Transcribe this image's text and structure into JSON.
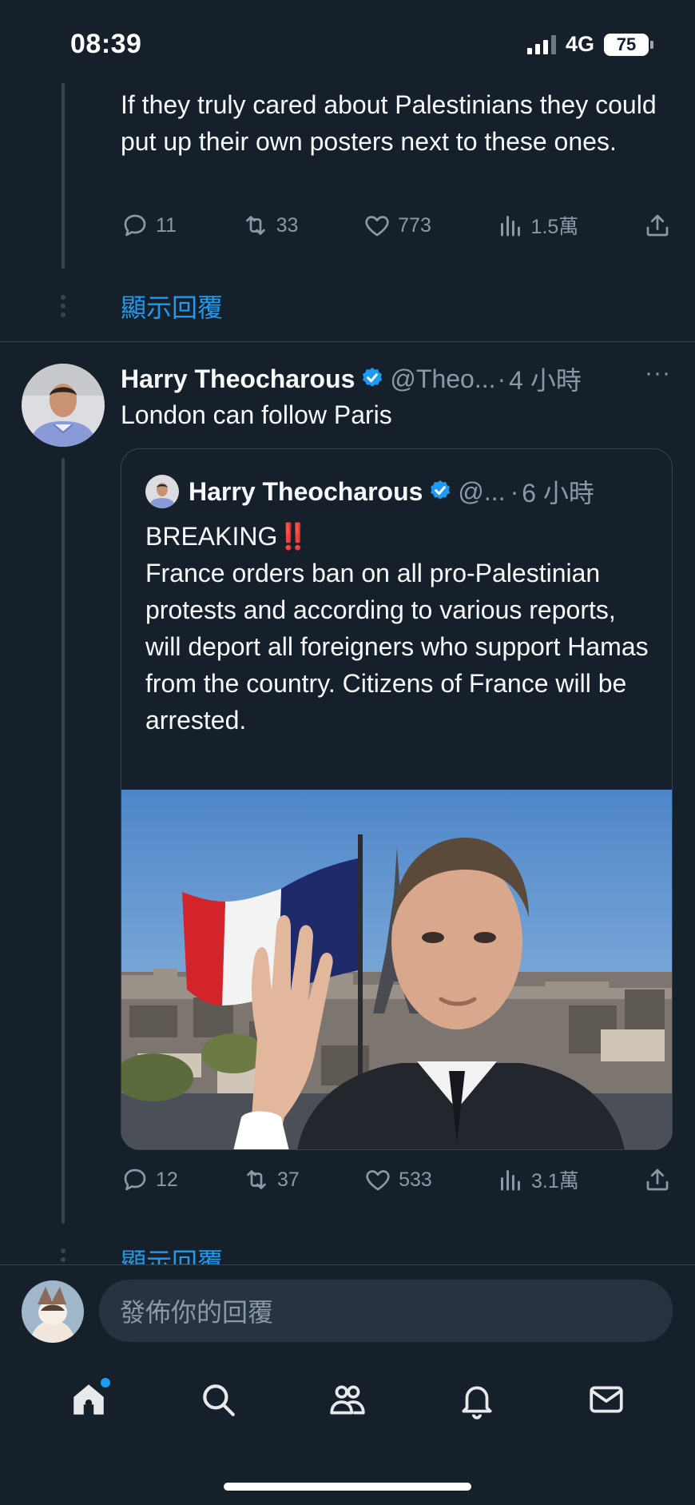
{
  "status_bar": {
    "time": "08:39",
    "network": "4G",
    "battery": "75"
  },
  "parent_reply": {
    "text": "If they truly cared about Palestinians they could put up their own posters next to these ones.",
    "replies": "11",
    "retweets": "33",
    "likes": "773",
    "views": "1.5萬",
    "show_replies": "顯示回覆"
  },
  "tweet": {
    "display_name": "Harry Theocharous",
    "handle": "@Theo...",
    "dot": "·",
    "time": "4 小時",
    "more": "···",
    "text": "London can follow Paris",
    "quote": {
      "display_name": "Harry Theocharous",
      "handle": "@...",
      "dot": "·",
      "time": "6 小時",
      "breaking": "BREAKING",
      "breaking_emoji": "‼️",
      "text": "France orders ban on all pro-Palestinian protests and according to various reports, will deport all foreigners who support Hamas from the country. Citizens of France will be arrested."
    },
    "replies": "12",
    "retweets": "37",
    "likes": "533",
    "views": "3.1萬",
    "show_replies": "顯示回覆"
  },
  "composer": {
    "placeholder": "發佈你的回覆"
  },
  "tabbar": {
    "items": [
      "home-icon",
      "search-icon",
      "communities-icon",
      "notifications-icon",
      "messages-icon"
    ]
  },
  "colors": {
    "background": "#15202b",
    "accent": "#1d9bf0",
    "muted": "#8b98a5",
    "border": "#38444d"
  }
}
